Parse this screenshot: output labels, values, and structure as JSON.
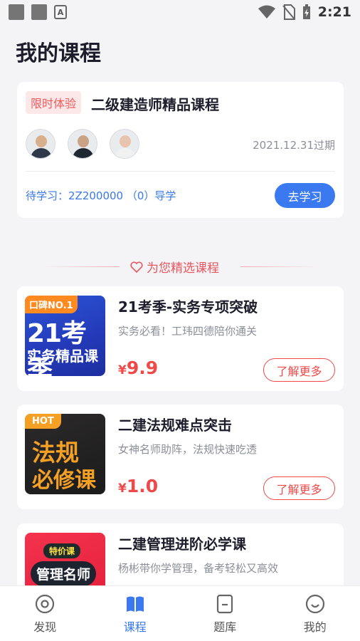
{
  "status_bar": {
    "time": "2:21"
  },
  "page_title": "我的课程",
  "my_course": {
    "badge": "限时体验",
    "title": "二级建造师精品课程",
    "expire": "2021.12.31过期",
    "pending": "待学习：2Z200000 （0）导学",
    "go_button": "去学习"
  },
  "section_title": "为您精选课程",
  "recommended": [
    {
      "title": "21考季-实务专项突破",
      "subtitle": "实务必看！工玮四德陪你通关",
      "currency": "¥",
      "price": "9.9",
      "button": "了解更多",
      "thumb": {
        "tag": "口碑NO.1",
        "big": "21考季",
        "small": "实务精品课"
      }
    },
    {
      "title": "二建法规难点突击",
      "subtitle": "女神名师助阵，法规快速吃透",
      "currency": "¥",
      "price": "1.0",
      "button": "了解更多",
      "thumb": {
        "tag": "HOT",
        "big": "法规",
        "small": "必修课"
      }
    },
    {
      "title": "二建管理进阶必学课",
      "subtitle": "杨彬带你学管理，备考轻松又高效",
      "thumb": {
        "tag": "特价课",
        "big": "管理名师"
      }
    }
  ],
  "tabs": [
    {
      "label": "发现",
      "icon": "compass-icon"
    },
    {
      "label": "课程",
      "icon": "book-icon",
      "active": true
    },
    {
      "label": "题库",
      "icon": "question-bank-icon"
    },
    {
      "label": "我的",
      "icon": "profile-icon"
    }
  ],
  "colors": {
    "accent": "#3a79f0",
    "price": "#f04949",
    "badge": "#f05a5a"
  }
}
